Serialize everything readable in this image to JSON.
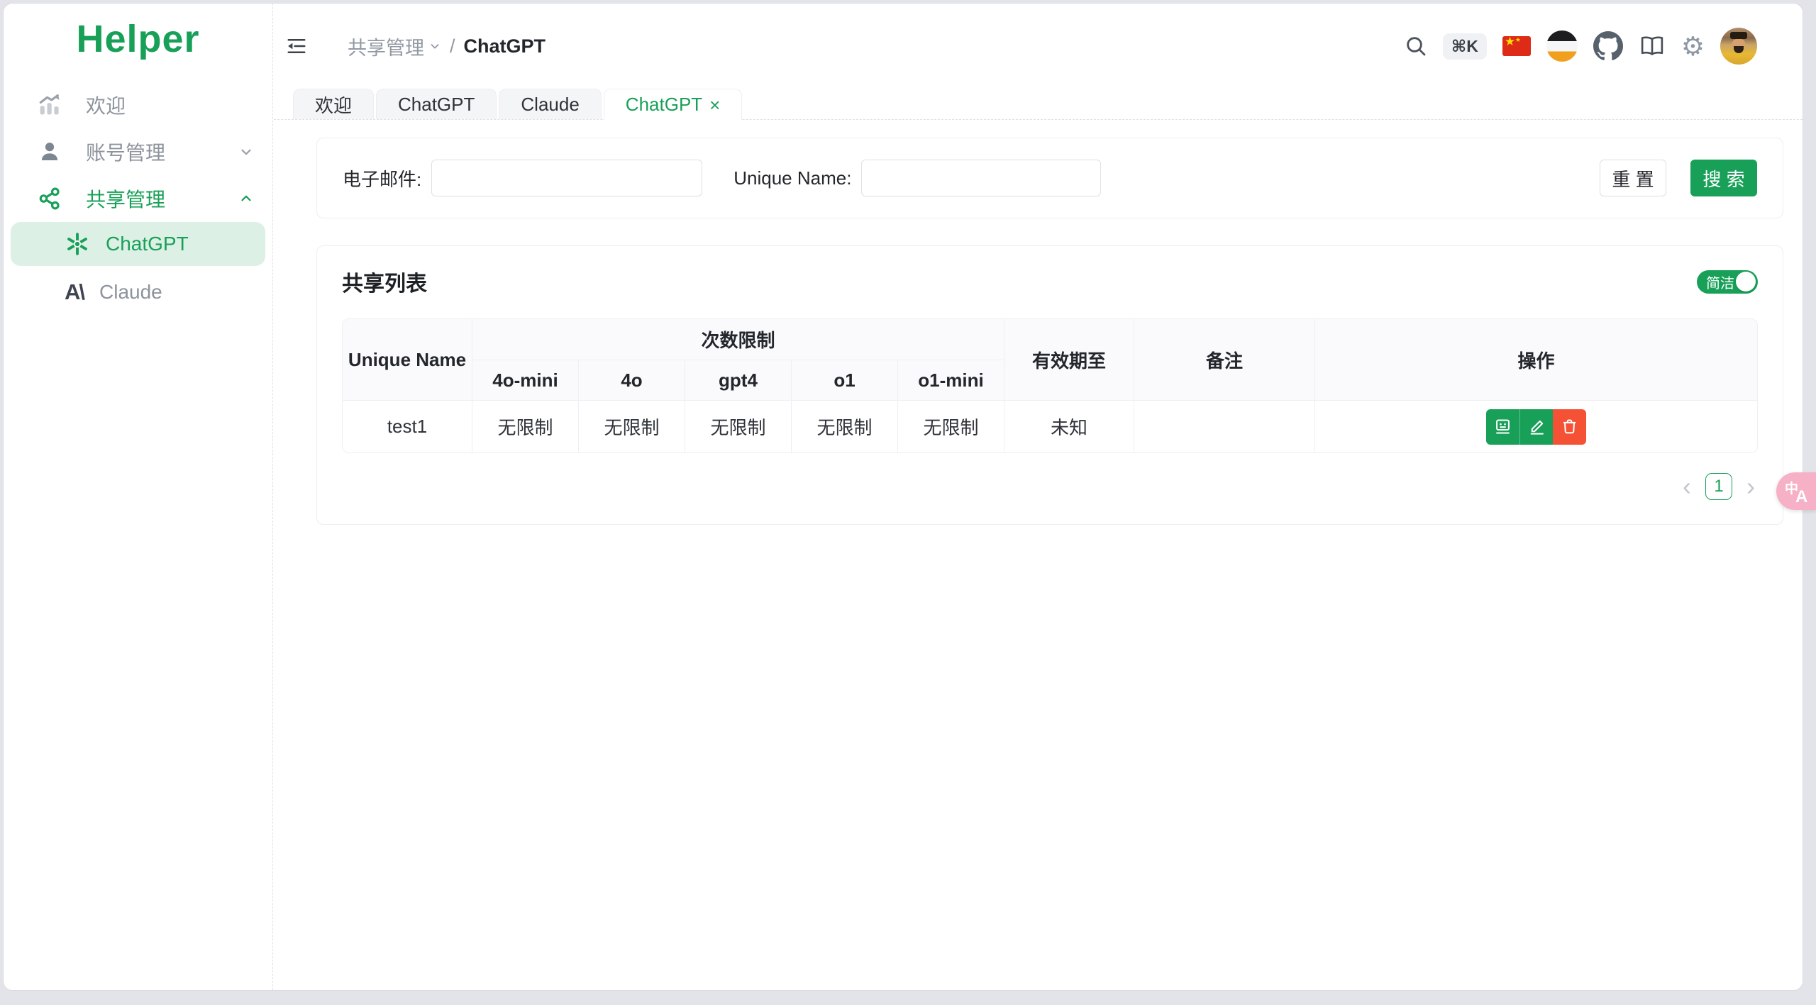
{
  "app": {
    "logo": "Helper"
  },
  "sidebar": {
    "items": [
      {
        "label": "欢迎"
      },
      {
        "label": "账号管理"
      },
      {
        "label": "共享管理"
      },
      {
        "label": "ChatGPT"
      },
      {
        "label": "Claude"
      }
    ],
    "claude_glyph": "A\\"
  },
  "topbar": {
    "breadcrumb": {
      "parent": "共享管理",
      "separator": "/",
      "current": "ChatGPT"
    },
    "shortcut": "⌘K",
    "flag_star_big": "★",
    "flag_star_small": "★",
    "gear_glyph": "⚙"
  },
  "tabs": [
    {
      "label": "欢迎"
    },
    {
      "label": "ChatGPT"
    },
    {
      "label": "Claude"
    },
    {
      "label": "ChatGPT",
      "close": "×"
    }
  ],
  "filter": {
    "email_label": "电子邮件:",
    "email_value": "",
    "unique_label": "Unique Name:",
    "unique_value": "",
    "reset_label": "重 置",
    "search_label": "搜 索"
  },
  "list": {
    "title": "共享列表",
    "toggle_label": "简洁",
    "table": {
      "col_unique": "Unique Name",
      "col_limits": "次数限制",
      "sub_cols": [
        "4o-mini",
        "4o",
        "gpt4",
        "o1",
        "o1-mini"
      ],
      "col_expire": "有效期至",
      "col_note": "备注",
      "col_actions": "操作",
      "rows": [
        {
          "unique": "test1",
          "limits": [
            "无限制",
            "无限制",
            "无限制",
            "无限制",
            "无限制"
          ],
          "expire": "未知",
          "note": ""
        }
      ]
    },
    "pagination": {
      "prev": "‹",
      "page": "1",
      "next": "›"
    }
  },
  "fab": {
    "zh": "中",
    "en": "A"
  },
  "colors": {
    "primary": "#18a058",
    "primary_light_bg": "#ddf0e6",
    "danger": "#f45135",
    "fab_pink": "#f7b1c6",
    "flag_red": "#de2b17"
  }
}
